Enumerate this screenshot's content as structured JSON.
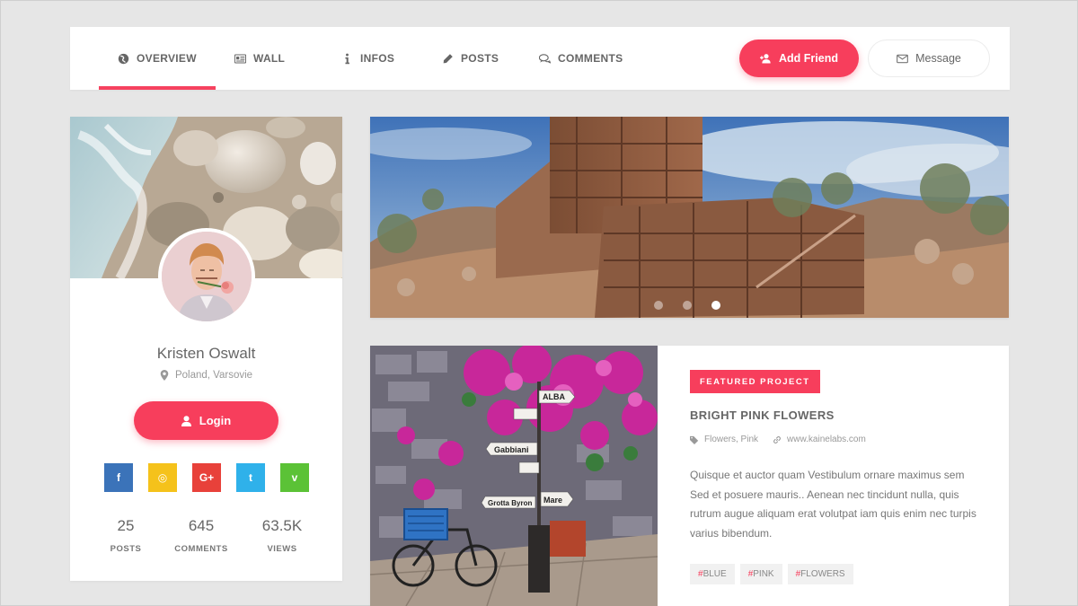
{
  "nav": {
    "tabs": [
      {
        "label": "OVERVIEW",
        "icon": "globe-icon",
        "active": true
      },
      {
        "label": "WALL",
        "icon": "id-card-icon",
        "active": false
      },
      {
        "label": "INFOS",
        "icon": "info-icon",
        "active": false
      },
      {
        "label": "POSTS",
        "icon": "pencil-icon",
        "active": false
      },
      {
        "label": "COMMENTS",
        "icon": "chat-bubbles-icon",
        "active": false
      }
    ],
    "add_friend_label": "Add Friend",
    "message_label": "Message"
  },
  "profile": {
    "name": "Kristen Oswalt",
    "location": "Poland, Varsovie",
    "login_label": "Login",
    "socials": [
      {
        "name": "facebook",
        "glyph": "f",
        "color": "#3b73b9"
      },
      {
        "name": "instagram",
        "glyph": "◎",
        "color": "#f5c21b"
      },
      {
        "name": "google-plus",
        "glyph": "G+",
        "color": "#e8413a"
      },
      {
        "name": "twitter",
        "glyph": "t",
        "color": "#2fb1ea"
      },
      {
        "name": "vine",
        "glyph": "v",
        "color": "#5bc236"
      }
    ],
    "stats": [
      {
        "value": "25",
        "label": "POSTS"
      },
      {
        "value": "645",
        "label": "COMMENTS"
      },
      {
        "value": "63.5K",
        "label": "VIEWS"
      }
    ]
  },
  "hero": {
    "slide_count": 3,
    "active_slide": 3
  },
  "featured": {
    "badge": "FEATURED PROJECT",
    "title": "BRIGHT PINK FLOWERS",
    "tags_meta": "Flowers, Pink",
    "website": "www.kainelabs.com",
    "description": "Quisque et auctor quam Vestibulum ornare maximus sem Sed et posuere mauris.. Aenean nec tincidunt nulla, quis rutrum augue aliquam erat volutpat iam quis enim nec turpis varius bibendum.",
    "image_signs": [
      "ALBA",
      "Gabbiani",
      "Mare",
      "Grotta Byron"
    ],
    "tags": [
      "BLUE",
      "PINK",
      "FLOWERS"
    ]
  },
  "colors": {
    "accent": "#f73e5c",
    "background": "#e6e6e6",
    "card": "#ffffff"
  }
}
